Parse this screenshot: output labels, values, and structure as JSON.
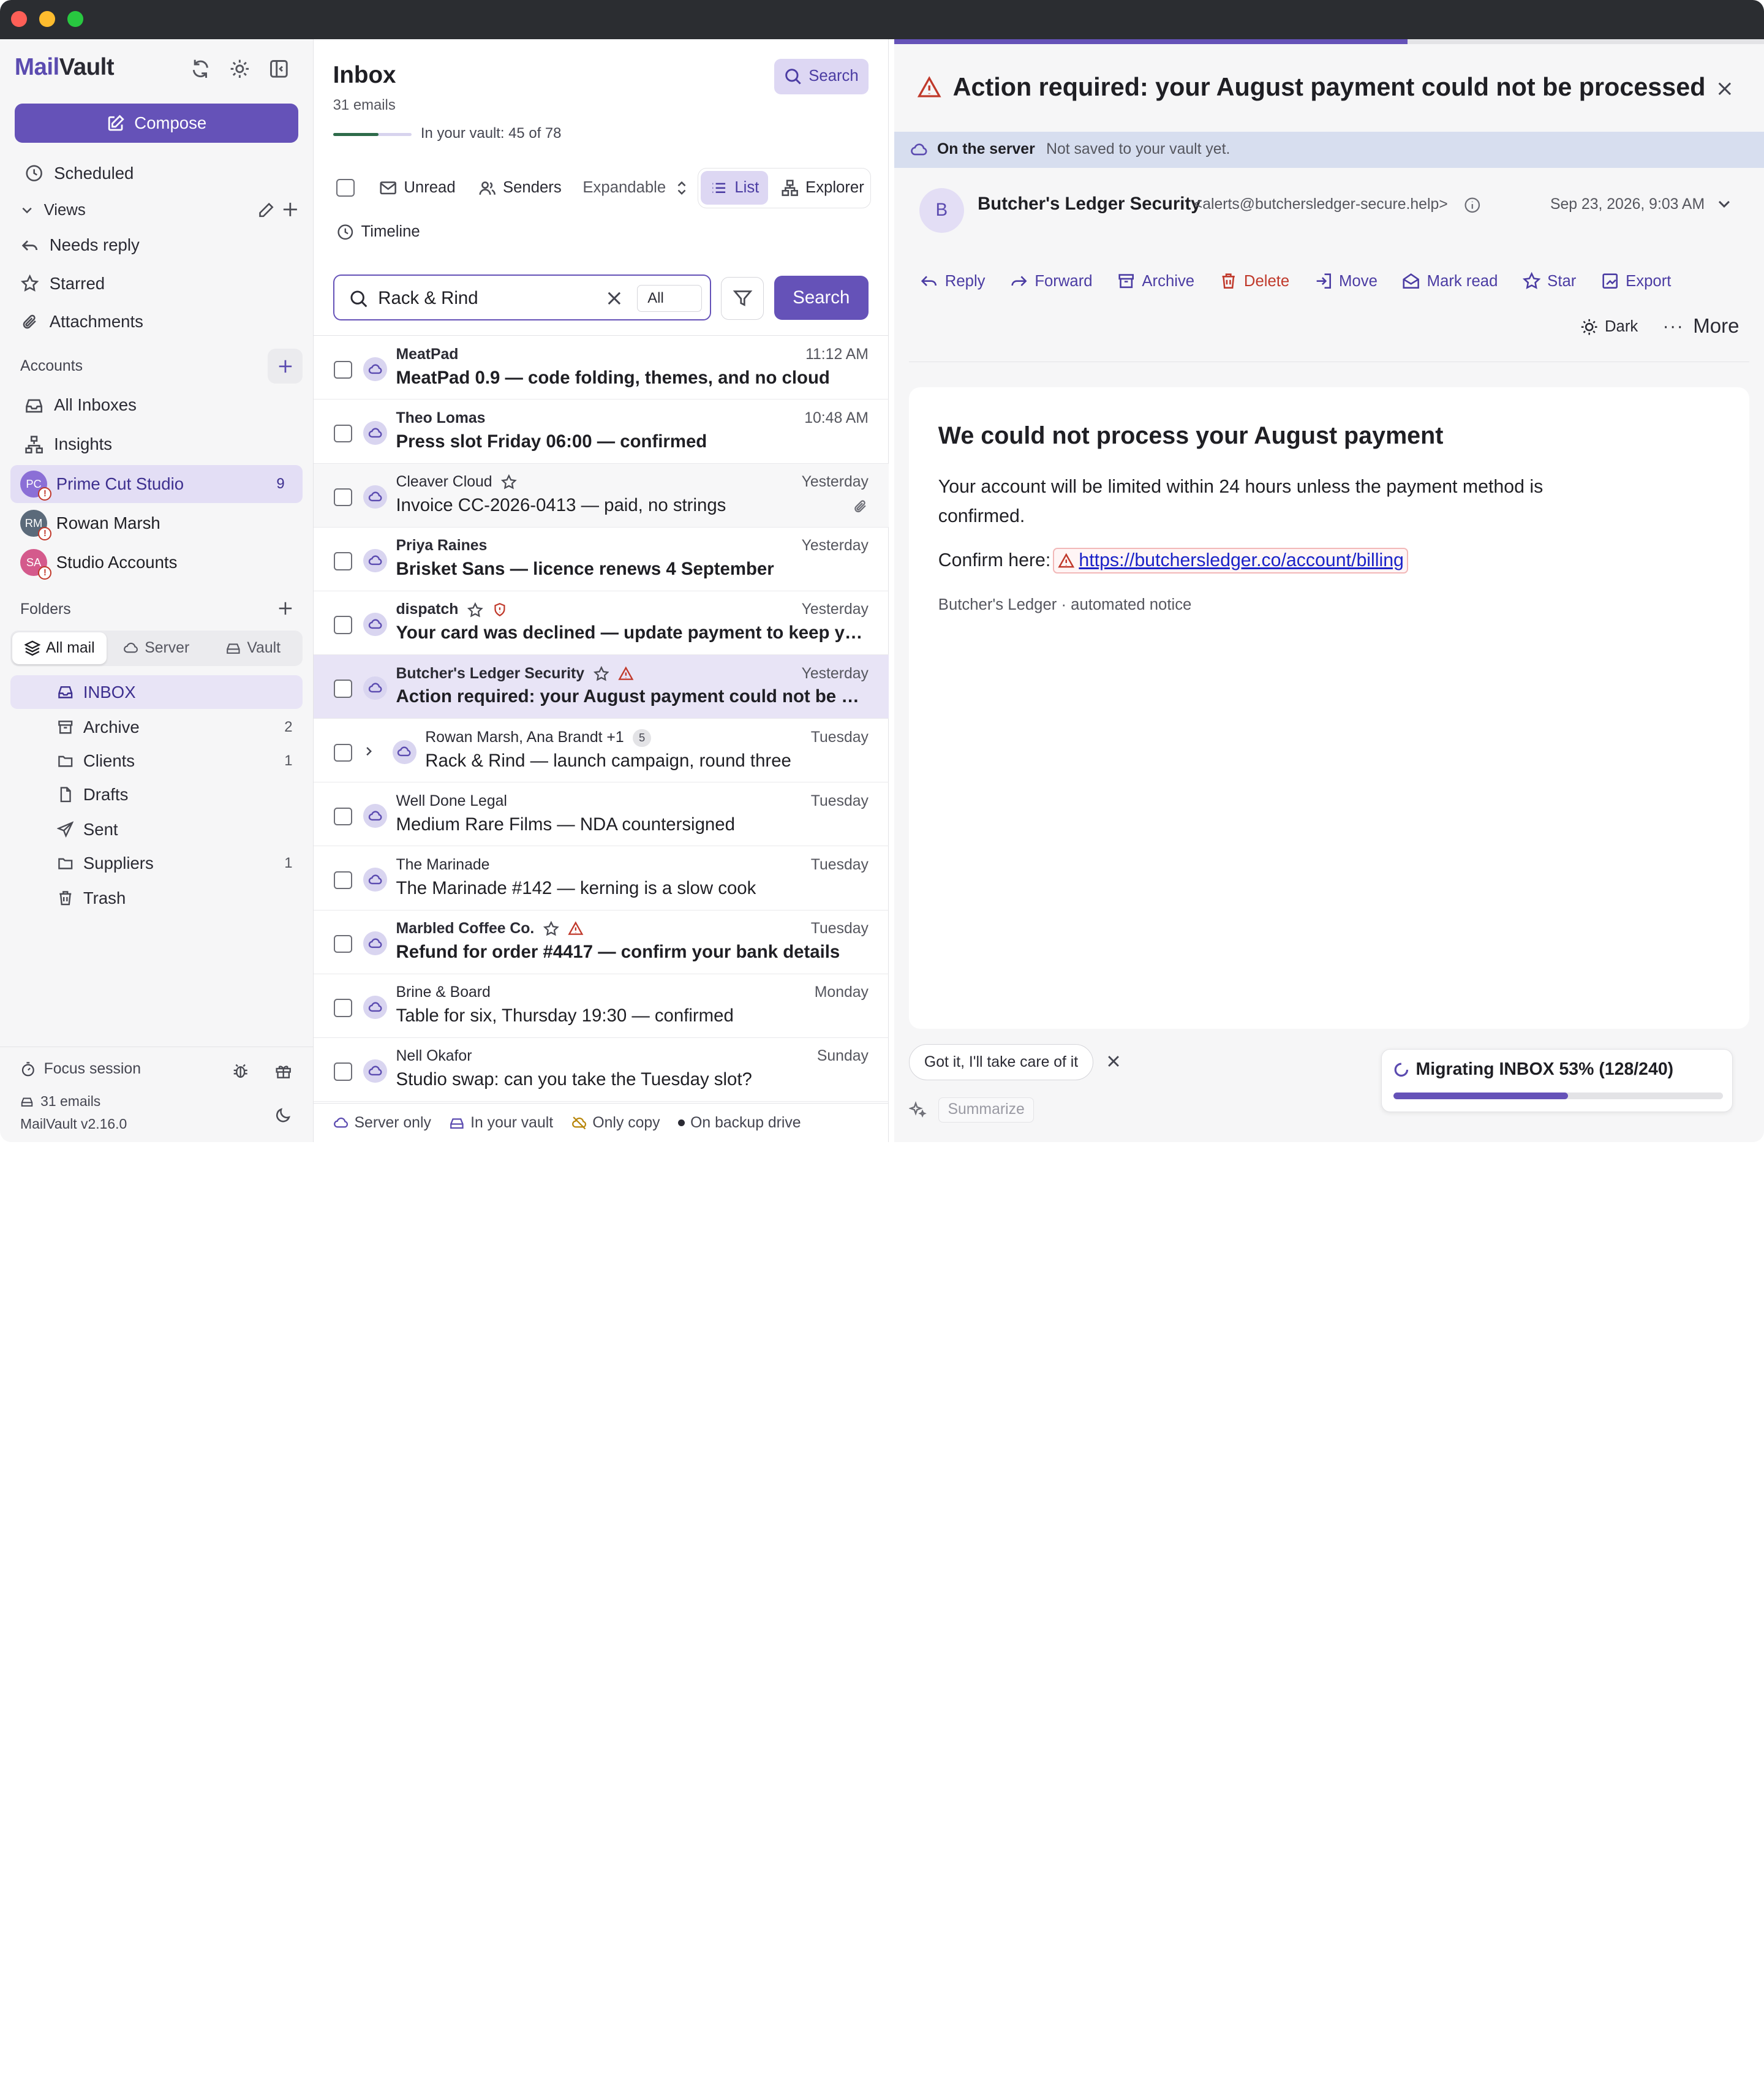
{
  "app": {
    "name_part1": "Mail",
    "name_part2": "Vault",
    "version": "MailVault v2.16.0",
    "accent": "#6552b8"
  },
  "sidebar": {
    "compose_label": "Compose",
    "scheduled_label": "Scheduled",
    "views_heading": "Views",
    "views": [
      {
        "label": "Needs reply",
        "icon": "reply-icon"
      },
      {
        "label": "Starred",
        "icon": "star-icon"
      },
      {
        "label": "Attachments",
        "icon": "paperclip-icon"
      }
    ],
    "accounts_heading": "Accounts",
    "all_inboxes_label": "All Inboxes",
    "insights_label": "Insights",
    "accounts": [
      {
        "initials": "PC",
        "name": "Prime Cut Studio",
        "count": "9",
        "color": "#8b6fd6"
      },
      {
        "initials": "RM",
        "name": "Rowan Marsh",
        "count": "",
        "color": "#5b6a7a"
      },
      {
        "initials": "SA",
        "name": "Studio Accounts",
        "count": "",
        "color": "#d45a8c"
      }
    ],
    "folders_heading": "Folders",
    "folder_filter": [
      "All mail",
      "Server",
      "Vault"
    ],
    "folders": [
      {
        "label": "INBOX",
        "count": "",
        "icon": "inbox-icon"
      },
      {
        "label": "Archive",
        "count": "2",
        "icon": "archive-icon"
      },
      {
        "label": "Clients",
        "count": "1",
        "icon": "folder-icon"
      },
      {
        "label": "Drafts",
        "count": "",
        "icon": "draft-icon"
      },
      {
        "label": "Sent",
        "count": "",
        "icon": "send-icon"
      },
      {
        "label": "Suppliers",
        "count": "1",
        "icon": "folder-icon"
      },
      {
        "label": "Trash",
        "count": "",
        "icon": "trash-icon"
      }
    ],
    "focus_label": "Focus session",
    "footer_count": "31 emails"
  },
  "list": {
    "title": "Inbox",
    "subtitle": "31 emails",
    "vault_note": "In your vault: 45 of 78",
    "vault_fraction": 0.58,
    "search_button": "Search",
    "toolbar": {
      "unread": "Unread",
      "senders": "Senders",
      "expandable": "Expandable",
      "list": "List",
      "explorer": "Explorer",
      "timeline": "Timeline"
    },
    "search_value": "Rack & Rind",
    "search_scope": "All",
    "search_go": "Search",
    "emails": [
      {
        "from": "MeatPad",
        "subject": "MeatPad 0.9 — code folding, themes, and no cloud",
        "time": "11:12 AM",
        "unread": true
      },
      {
        "from": "Theo Lomas",
        "subject": "Press slot Friday 06:00 — confirmed",
        "time": "10:48 AM",
        "unread": true
      },
      {
        "from": "Cleaver Cloud",
        "subject": "Invoice CC-2026-0413 — paid, no strings",
        "time": "Yesterday",
        "unread": false
      },
      {
        "from": "Priya Raines",
        "subject": "Brisket Sans — licence renews 4 September",
        "time": "Yesterday",
        "unread": true
      },
      {
        "from": "dispatch",
        "subject": "Your card was declined — update payment to keep your o…",
        "time": "Yesterday",
        "unread": true
      },
      {
        "from": "Butcher's Ledger Security",
        "subject": "Action required: your August payment could not be proc…",
        "time": "Yesterday",
        "unread": true
      },
      {
        "from": "Rowan Marsh, Ana Brandt +1",
        "subject": "Rack & Rind — launch campaign, round three",
        "time": "Tuesday",
        "unread": false,
        "thread_count": "5"
      },
      {
        "from": "Well Done Legal",
        "subject": "Medium Rare Films — NDA countersigned",
        "time": "Tuesday",
        "unread": false
      },
      {
        "from": "The Marinade",
        "subject": "The Marinade #142 — kerning is a slow cook",
        "time": "Tuesday",
        "unread": false
      },
      {
        "from": "Marbled Coffee Co.",
        "subject": "Refund for order #4417 — confirm your bank details",
        "time": "Tuesday",
        "unread": true
      },
      {
        "from": "Brine & Board",
        "subject": "Table for six, Thursday 19:30 — confirmed",
        "time": "Monday",
        "unread": false
      },
      {
        "from": "Nell Okafor",
        "subject": "Studio swap: can you take the Tuesday slot?",
        "time": "Sunday",
        "unread": false
      }
    ],
    "legend": [
      "Server only",
      "In your vault",
      "Only copy",
      "On backup drive"
    ]
  },
  "reader": {
    "title": "Action required: your August payment could not be processed",
    "server_label": "On the server",
    "server_note": "Not saved to your vault yet.",
    "sender_initial": "B",
    "sender_name": "Butcher's Ledger Security",
    "sender_email": "<alerts@butchersledger-secure.help>",
    "date": "Sep 23, 2026, 9:03 AM",
    "actions": [
      "Reply",
      "Forward",
      "Archive",
      "Delete",
      "Move",
      "Mark read",
      "Star",
      "Export"
    ],
    "dark_label": "Dark",
    "more_label": "More",
    "body": {
      "heading": "We could not process your August payment",
      "para": "Your account will be limited within 24 hours unless the payment method is confirmed.",
      "confirm_prefix": "Confirm here:",
      "link": "https://butchersledger.co/account/billing",
      "signature": "Butcher's Ledger · automated notice"
    },
    "got_it": "Got it, I'll take care of it",
    "summarize": "Summarize",
    "migration": {
      "label": "Migrating INBOX 53% (128/240)",
      "progress": 0.53
    }
  }
}
